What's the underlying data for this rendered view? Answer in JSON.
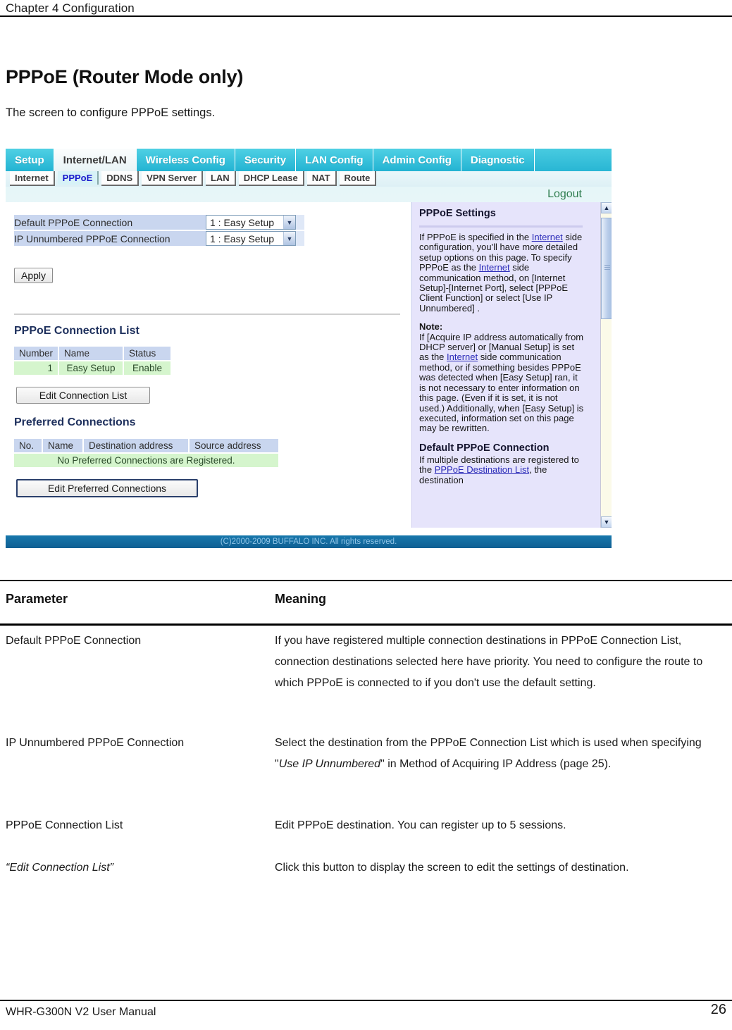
{
  "running_head": "Chapter 4  Configuration",
  "page_title": "PPPoE (Router Mode only)",
  "page_intro": "The screen to configure PPPoE settings.",
  "screenshot": {
    "main_tabs": [
      {
        "label": "Setup",
        "active": false
      },
      {
        "label": "Internet/LAN",
        "active": true
      },
      {
        "label": "Wireless Config",
        "active": false
      },
      {
        "label": "Security",
        "active": false
      },
      {
        "label": "LAN Config",
        "active": false
      },
      {
        "label": "Admin Config",
        "active": false
      },
      {
        "label": "Diagnostic",
        "active": false
      }
    ],
    "sub_tabs": [
      {
        "label": "Internet",
        "active": false
      },
      {
        "label": "PPPoE",
        "active": true
      },
      {
        "label": "DDNS",
        "active": false
      },
      {
        "label": "VPN Server",
        "active": false
      },
      {
        "label": "LAN",
        "active": false
      },
      {
        "label": "DHCP Lease",
        "active": false
      },
      {
        "label": "NAT",
        "active": false
      },
      {
        "label": "Route",
        "active": false
      }
    ],
    "logout_label": "Logout",
    "settings": {
      "rows": [
        {
          "label": "Default PPPoE Connection",
          "value": "1 : Easy Setup"
        },
        {
          "label": "IP Unnumbered PPPoE Connection",
          "value": "1 : Easy Setup"
        }
      ],
      "apply_label": "Apply"
    },
    "connection_list": {
      "title": "PPPoE Connection List",
      "headers": [
        "Number",
        "Name",
        "Status"
      ],
      "rows": [
        [
          "1",
          "Easy Setup",
          "Enable"
        ]
      ],
      "edit_button": "Edit Connection List"
    },
    "preferred_connections": {
      "title": "Preferred Connections",
      "headers": [
        "No.",
        "Name",
        "Destination address",
        "Source address"
      ],
      "empty_message": "No Preferred Connections are Registered.",
      "edit_button": "Edit Preferred Connections"
    },
    "help": {
      "title": "PPPoE Settings",
      "para1_a": "If PPPoE is specified in the ",
      "link1": "Internet",
      "para1_b": " side configuration, you'll have more detailed setup options on this page. To specify PPPoE as the ",
      "link2": "Internet",
      "para1_c": " side communication method, on [Internet Setup]-[Internet Port], select [PPPoE Client Function] or select [Use IP Unnumbered] .",
      "note_label": "Note:",
      "note_a": "If [Acquire IP address automatically from DHCP server] or [Manual Setup] is set as the ",
      "note_link": "Internet",
      "note_b": " side communication method, or if something besides PPPoE was detected when [Easy Setup] ran, it is not necessary to enter information on this page. (Even if it is set, it is not used.) Additionally, when [Easy Setup] is executed, information set on this page may be rewritten.",
      "title2": "Default PPPoE Connection",
      "para2_a": "If multiple destinations are registered to the ",
      "link3": "PPPoE Destination List",
      "para2_b": ", the destination"
    },
    "copyright": "(C)2000-2009 BUFFALO INC. All rights reserved."
  },
  "param_table": {
    "header_parameter": "Parameter",
    "header_meaning": "Meaning",
    "rows": [
      {
        "parameter": "Default PPPoE Connection",
        "meaning": "If you have registered multiple connection destinations in PPPoE Connection List, connection destinations selected here have priority. You need to configure the route to which PPPoE is connected to if you don't use the default setting."
      },
      {
        "parameter": "IP Unnumbered PPPoE Connection",
        "meaning_a": "Select the destination from the PPPoE Connection List which is used when specifying \"",
        "meaning_em": "Use IP Unnumbered",
        "meaning_b": "\" in Method of Acquiring IP Address (page 25)."
      },
      {
        "parameter": "PPPoE Connection List",
        "meaning": "Edit PPPoE destination. You can register up to 5 sessions."
      },
      {
        "parameter_em": "“Edit Connection List”",
        "meaning": "Click this button to display the screen to edit the settings of destination."
      }
    ]
  },
  "footer": {
    "manual": "WHR-G300N V2 User Manual",
    "page_number": "26"
  }
}
